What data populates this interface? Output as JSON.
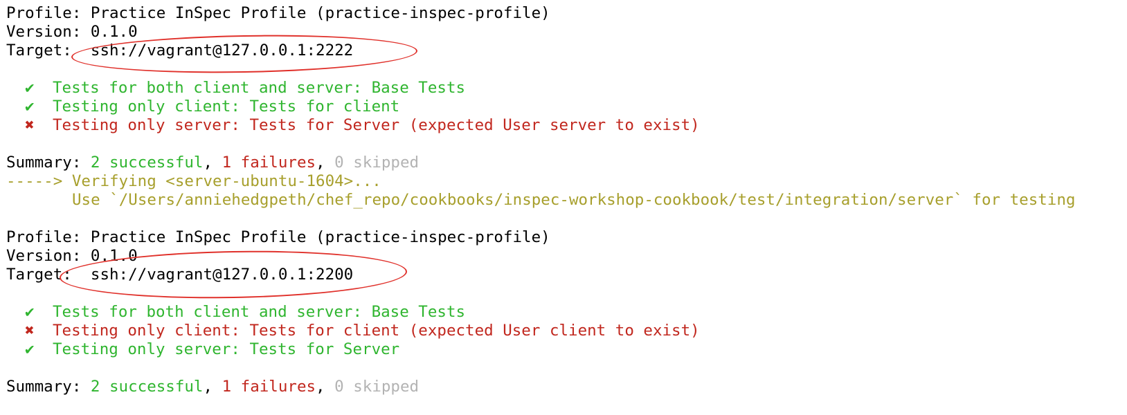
{
  "blocks": [
    {
      "profile": "Profile: Practice InSpec Profile (practice-inspec-profile)",
      "version_label": "Version:",
      "version_value": "0.1.0",
      "target_label": "Target:",
      "target_value": "ssh://vagrant@127.0.0.1:2222",
      "checks": [
        {
          "status": "pass",
          "icon": "check-mark-icon",
          "mark": "✔",
          "text": "Tests for both client and server: Base Tests"
        },
        {
          "status": "pass",
          "icon": "check-mark-icon",
          "mark": "✔",
          "text": "Testing only client: Tests for client"
        },
        {
          "status": "fail",
          "icon": "cross-mark-icon",
          "mark": "✖",
          "text": "Testing only server: Tests for Server (expected User server to exist)"
        }
      ],
      "summary": {
        "label": "Summary:",
        "successful": "2 successful",
        "failures": "1 failures",
        "skipped": "0 skipped",
        "sep": ", "
      }
    },
    {
      "profile": "Profile: Practice InSpec Profile (practice-inspec-profile)",
      "version_label": "Version:",
      "version_value": "0.1.0",
      "target_label": "Target:",
      "target_value": "ssh://vagrant@127.0.0.1:2200",
      "checks": [
        {
          "status": "pass",
          "icon": "check-mark-icon",
          "mark": "✔",
          "text": "Tests for both client and server: Base Tests"
        },
        {
          "status": "fail",
          "icon": "cross-mark-icon",
          "mark": "✖",
          "text": "Testing only client: Tests for client (expected User client to exist)"
        },
        {
          "status": "pass",
          "icon": "check-mark-icon",
          "mark": "✔",
          "text": "Testing only server: Tests for Server"
        }
      ],
      "summary": {
        "label": "Summary:",
        "successful": "2 successful",
        "failures": "1 failures",
        "skipped": "0 skipped",
        "sep": ", "
      }
    }
  ],
  "verifying": {
    "line1": "-----> Verifying <server-ubuntu-1604>...",
    "line2": "Use `/Users/anniehedgpeth/chef_repo/cookbooks/inspec-workshop-cookbook/test/integration/server` for testing"
  },
  "colors": {
    "pass": "#2fb52f",
    "fail": "#c1271e",
    "skipped": "#b3b3b3",
    "verifying": "#a79f2c",
    "annotation": "#e0302a"
  }
}
